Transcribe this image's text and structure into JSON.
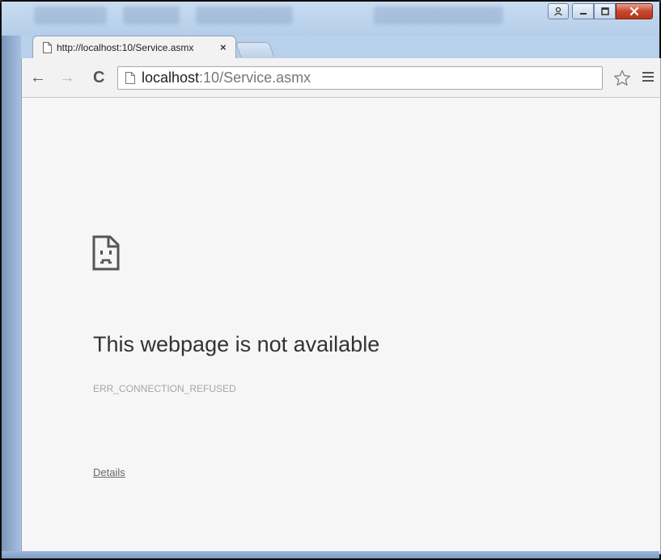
{
  "tab": {
    "title": "http://localhost:10/Service.asmx",
    "close_glyph": "×"
  },
  "toolbar": {
    "back_glyph": "←",
    "forward_glyph": "→",
    "reload_glyph": "C",
    "url_host": "localhost",
    "url_path": ":10/Service.asmx"
  },
  "error": {
    "title": "This webpage is not available",
    "code": "ERR_CONNECTION_REFUSED",
    "details_label": "Details"
  },
  "icons": {
    "page": "document-icon",
    "error": "sad-page-icon",
    "bookmark": "star-icon",
    "menu": "hamburger-menu-icon",
    "user": "user-icon"
  },
  "colors": {
    "window_frame": "#a9c4e4",
    "close_button": "#c9462c",
    "page_background": "#f6f6f6",
    "error_title": "#333333",
    "error_code": "#a6a6a6"
  }
}
